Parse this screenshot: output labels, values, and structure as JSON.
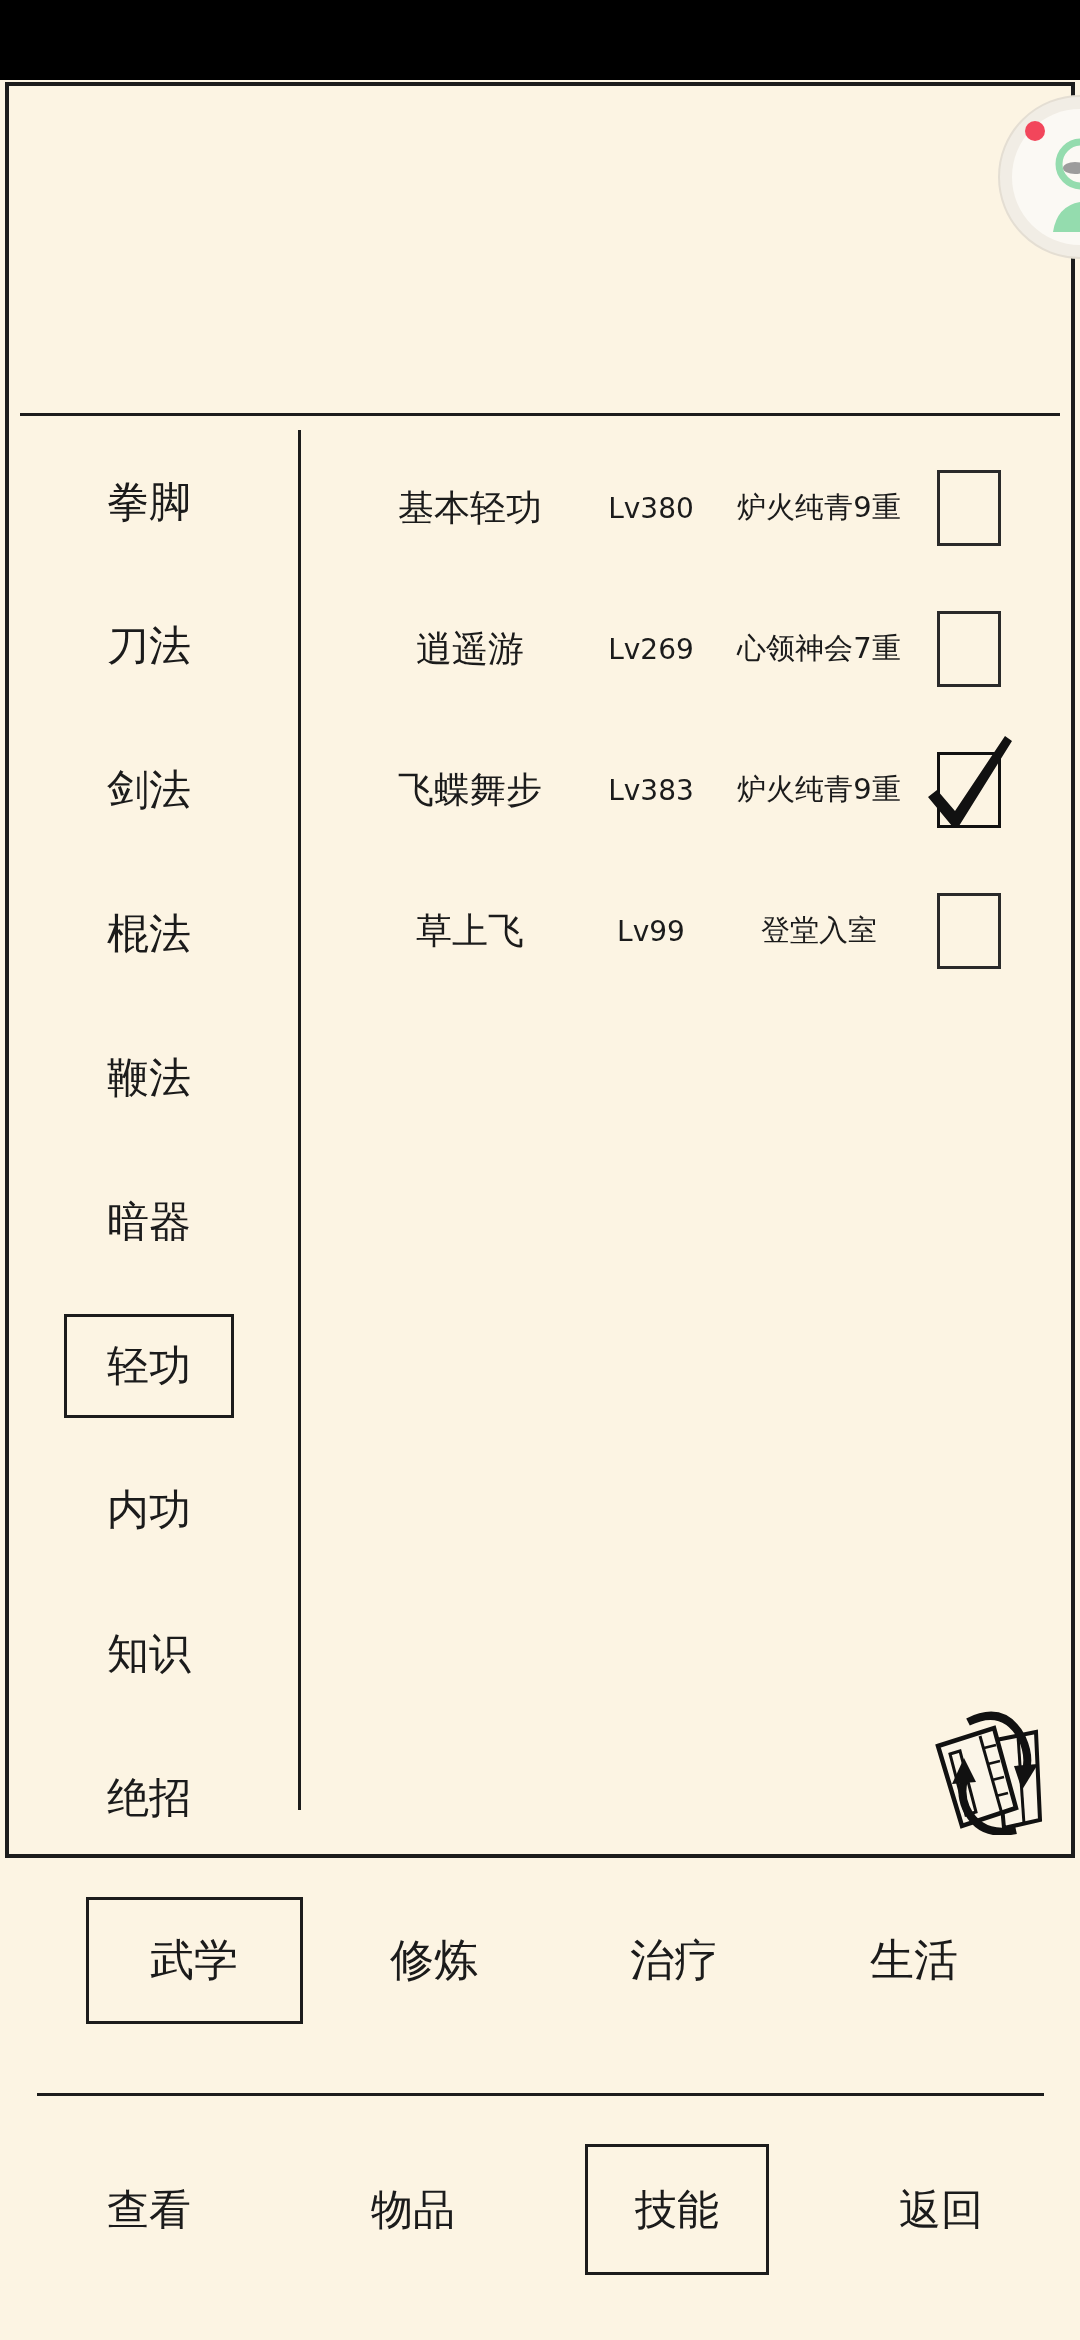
{
  "sidebar": {
    "items": [
      {
        "label": "拳脚",
        "selected": false
      },
      {
        "label": "刀法",
        "selected": false
      },
      {
        "label": "剑法",
        "selected": false
      },
      {
        "label": "棍法",
        "selected": false
      },
      {
        "label": "鞭法",
        "selected": false
      },
      {
        "label": "暗器",
        "selected": false
      },
      {
        "label": "轻功",
        "selected": true
      },
      {
        "label": "内功",
        "selected": false
      },
      {
        "label": "知识",
        "selected": false
      },
      {
        "label": "绝招",
        "selected": false
      }
    ]
  },
  "skills": [
    {
      "name": "基本轻功",
      "lv": "Lv380",
      "rank": "炉火纯青9重",
      "checked": false
    },
    {
      "name": "逍遥游",
      "lv": "Lv269",
      "rank": "心领神会7重",
      "checked": false
    },
    {
      "name": "飞蝶舞步",
      "lv": "Lv383",
      "rank": "炉火纯青9重",
      "checked": true
    },
    {
      "name": "草上飞",
      "lv": "Lv99",
      "rank": "登堂入室",
      "checked": false
    }
  ],
  "category_tabs": [
    {
      "label": "武学",
      "selected": true
    },
    {
      "label": "修炼",
      "selected": false
    },
    {
      "label": "治疗",
      "selected": false
    },
    {
      "label": "生活",
      "selected": false
    }
  ],
  "nav": [
    {
      "label": "查看",
      "selected": false
    },
    {
      "label": "物品",
      "selected": false
    },
    {
      "label": "技能",
      "selected": true
    },
    {
      "label": "返回",
      "selected": false
    }
  ]
}
